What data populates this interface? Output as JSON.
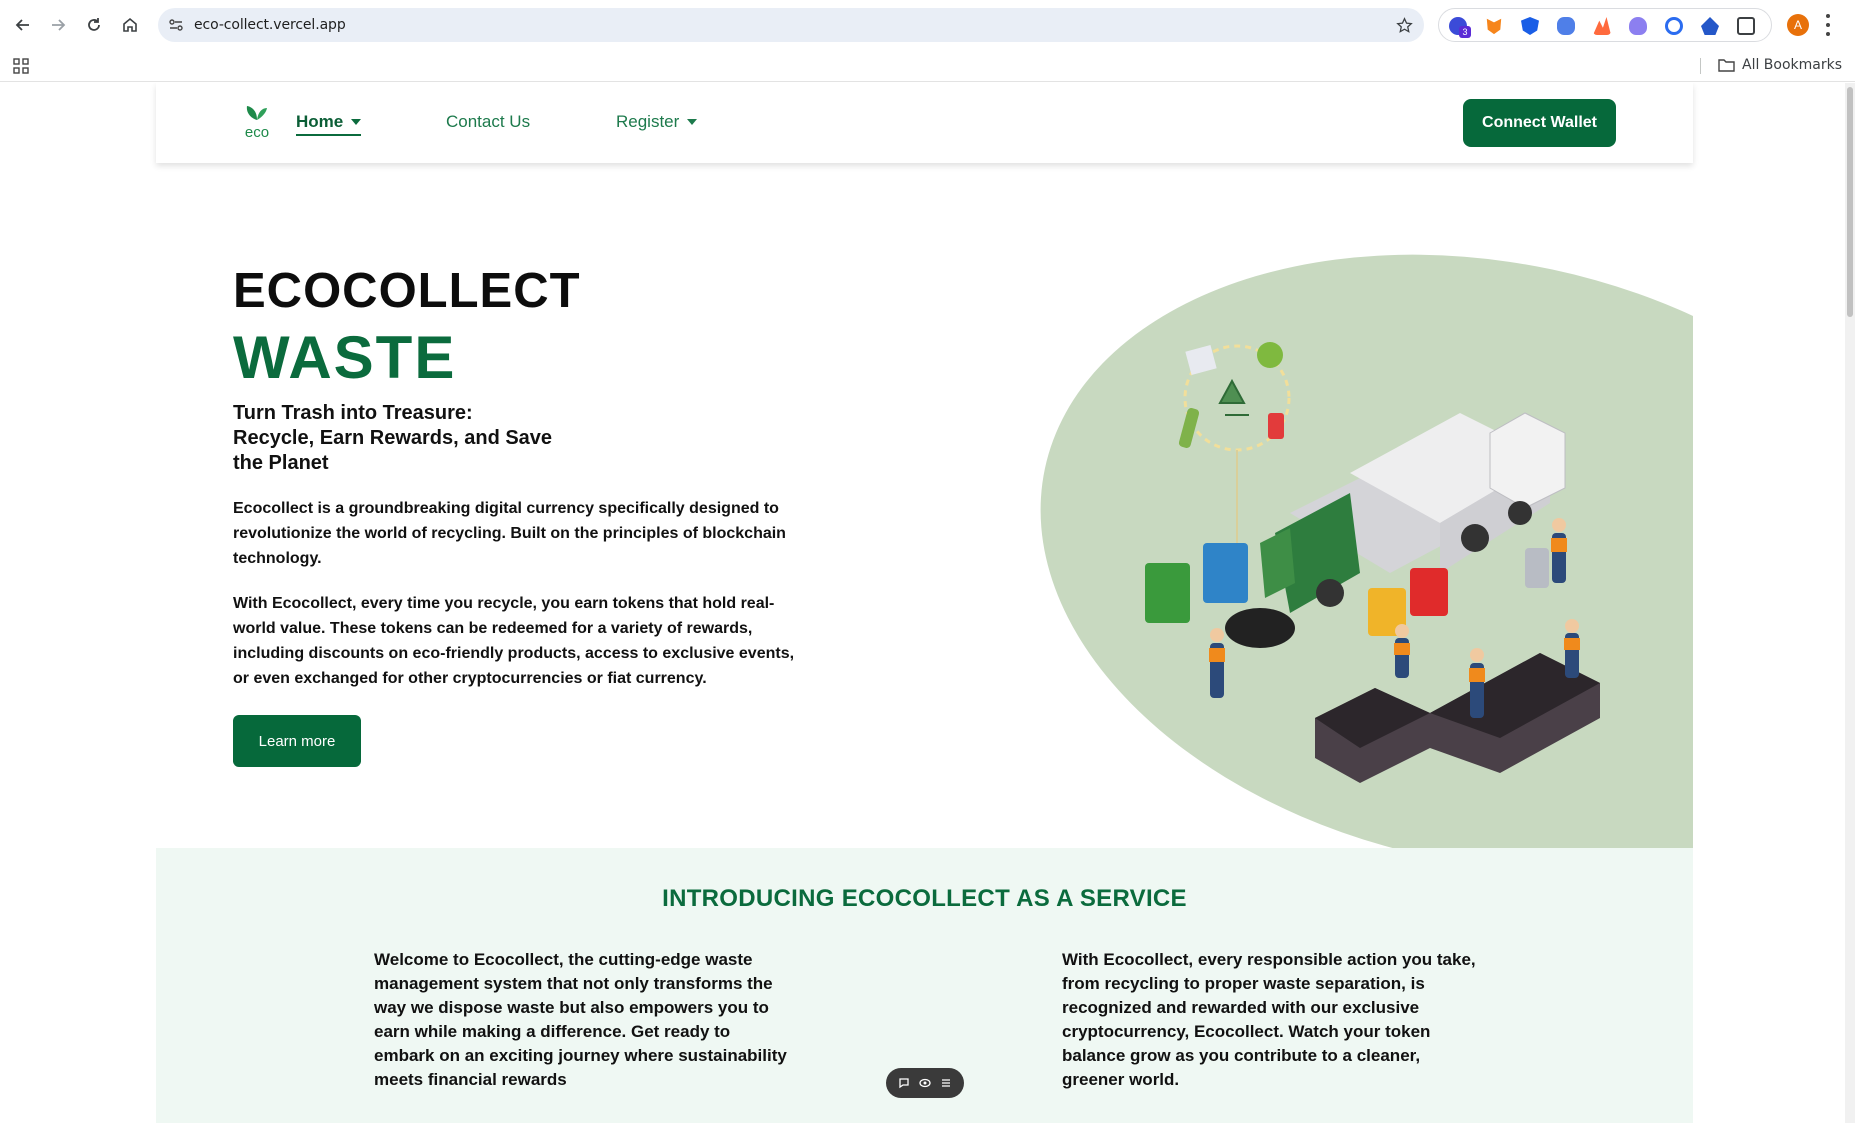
{
  "browser": {
    "url": "eco-collect.vercel.app",
    "bookmarks_label": "All Bookmarks",
    "extension_badge": "3",
    "profile_initial": "A"
  },
  "header": {
    "nav": [
      {
        "label": "Home",
        "has_dropdown": true,
        "active": true
      },
      {
        "label": "Contact Us",
        "has_dropdown": false,
        "active": false
      },
      {
        "label": "Register",
        "has_dropdown": true,
        "active": false
      }
    ],
    "connect_label": "Connect Wallet"
  },
  "hero": {
    "title_line1": "ECOCOLLECT",
    "title_line2": "WASTE",
    "subtitle": "Turn Trash into Treasure: Recycle, Earn Rewards, and Save the Planet",
    "paragraph1": "Ecocollect is a groundbreaking digital currency specifically designed to revolutionize the world of recycling. Built on the principles of blockchain technology.",
    "paragraph2": "With Ecocollect, every time you recycle, you earn tokens that hold real-world value. These tokens can be redeemed for a variety of rewards, including discounts on eco-friendly products, access to exclusive events, or even exchanged for other cryptocurrencies or fiat currency.",
    "cta_label": "Learn more"
  },
  "intro": {
    "title": "INTRODUCING ECOCOLLECT AS A SERVICE",
    "left_text": "Welcome to Ecocollect, the cutting-edge waste management system that not only transforms the way we dispose waste but also empowers you to earn while making a difference. Get ready to embark on an exciting journey where sustainability meets financial rewards",
    "right_text": "With Ecocollect, every responsible action you take, from recycling to proper waste separation, is recognized and rewarded with our exclusive cryptocurrency, Ecocollect. Watch your token balance grow as you contribute to a cleaner, greener world."
  },
  "colors": {
    "brand_green": "#06693b",
    "blob_green": "#c8d9c0",
    "section_bg": "#eff8f3"
  },
  "logo_text": "eco"
}
